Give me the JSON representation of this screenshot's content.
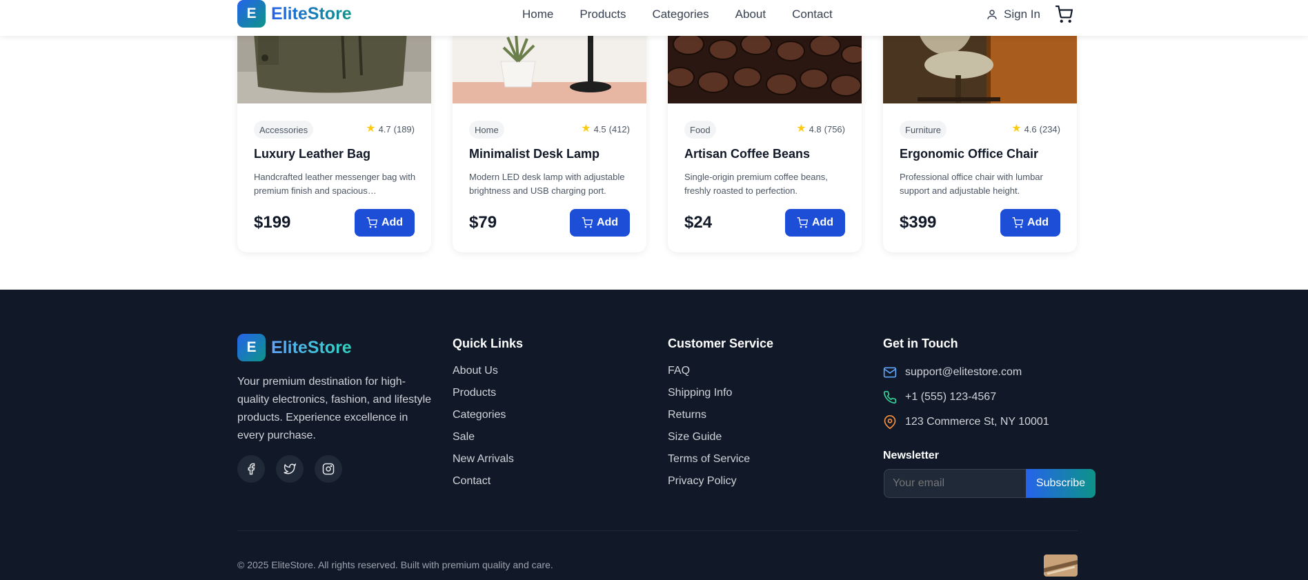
{
  "brand": {
    "initial": "E",
    "name": "EliteStore"
  },
  "nav": {
    "links": [
      "Home",
      "Products",
      "Categories",
      "About",
      "Contact"
    ],
    "signin_label": "Sign In"
  },
  "products": [
    {
      "category": "Accessories",
      "rating": "4.7",
      "reviews": "(189)",
      "title": "Luxury Leather Bag",
      "description": "Handcrafted leather messenger bag with premium finish and spacious compartments.",
      "price": "$199",
      "add_label": "Add",
      "image_icon": "leather-bag-photo"
    },
    {
      "category": "Home",
      "rating": "4.5",
      "reviews": "(412)",
      "title": "Minimalist Desk Lamp",
      "description": "Modern LED desk lamp with adjustable brightness and USB charging port.",
      "price": "$79",
      "add_label": "Add",
      "image_icon": "desk-lamp-photo"
    },
    {
      "category": "Food",
      "rating": "4.8",
      "reviews": "(756)",
      "title": "Artisan Coffee Beans",
      "description": "Single-origin premium coffee beans, freshly roasted to perfection.",
      "price": "$24",
      "add_label": "Add",
      "image_icon": "coffee-beans-photo"
    },
    {
      "category": "Furniture",
      "rating": "4.6",
      "reviews": "(234)",
      "title": "Ergonomic Office Chair",
      "description": "Professional office chair with lumbar support and adjustable height.",
      "price": "$399",
      "add_label": "Add",
      "image_icon": "office-chair-photo"
    }
  ],
  "footer": {
    "description": "Your premium destination for high-quality electronics, fashion, and lifestyle products. Experience excellence in every purchase.",
    "socials": [
      "facebook-icon",
      "twitter-icon",
      "instagram-icon"
    ],
    "quick_links": {
      "title": "Quick Links",
      "items": [
        "About Us",
        "Products",
        "Categories",
        "Sale",
        "New Arrivals",
        "Contact"
      ]
    },
    "customer_service": {
      "title": "Customer Service",
      "items": [
        "FAQ",
        "Shipping Info",
        "Returns",
        "Size Guide",
        "Terms of Service",
        "Privacy Policy"
      ]
    },
    "contact": {
      "title": "Get in Touch",
      "email": "support@elitestore.com",
      "phone": "+1 (555) 123-4567",
      "address": "123 Commerce St, NY 10001"
    },
    "newsletter": {
      "title": "Newsletter",
      "placeholder": "Your email",
      "button": "Subscribe"
    },
    "copyright": "© 2025 EliteStore. All rights reserved. Built with premium quality and care."
  },
  "colors": {
    "primary": "#1d4ed8",
    "accent": "#0d9488",
    "footer_bg": "#111827",
    "star": "#facc15"
  }
}
